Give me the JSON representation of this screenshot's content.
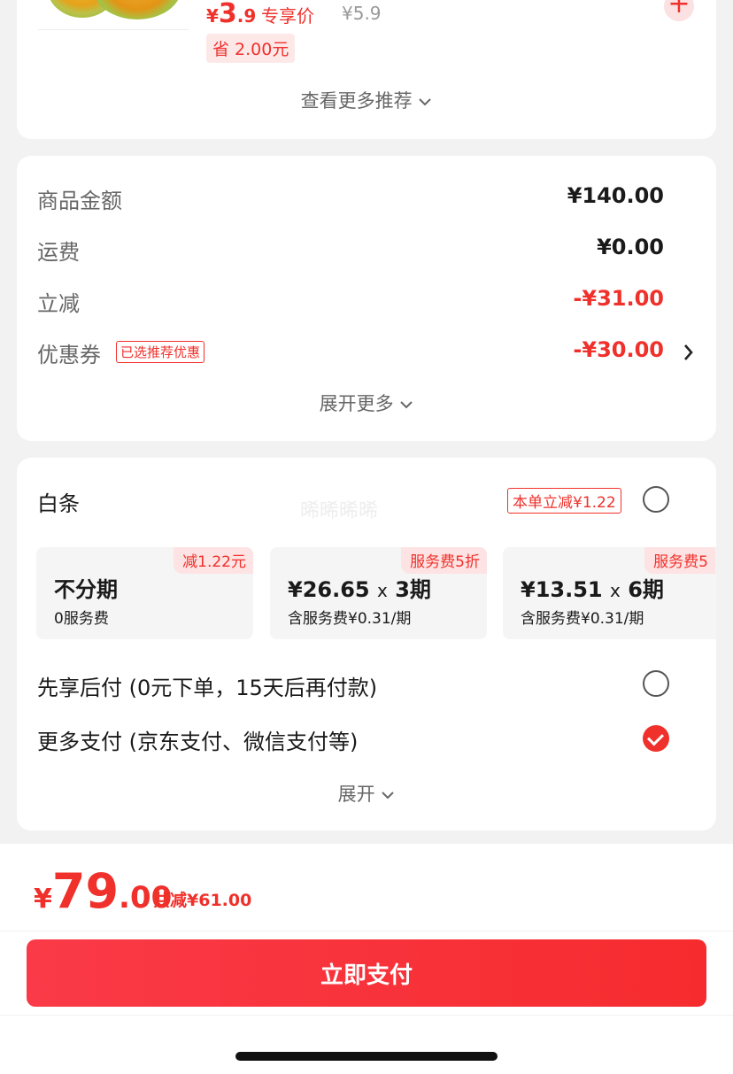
{
  "recommendation": {
    "price_symbol": "¥",
    "price_int": "3",
    "price_dec": ".9",
    "exclusive_label": "专享价",
    "original_price": "¥5.9",
    "save_label": "省 2.00元",
    "more_label": "查看更多推荐"
  },
  "amount": {
    "rows": [
      {
        "label": "商品金额",
        "value": "¥140.00"
      },
      {
        "label": "运费",
        "value": "¥0.00"
      },
      {
        "label": "立减",
        "value": "-¥31.00"
      },
      {
        "label": "优惠券",
        "value": "-¥30.00",
        "tag": "已选推荐优惠"
      }
    ],
    "expand_more": "展开更多"
  },
  "payment": {
    "baitiao_label": "白条",
    "watermark": "晞晞晞晞",
    "instant_discount": "本单立减¥1.22",
    "plans": [
      {
        "tag": "减1.22元",
        "main": "不分期",
        "sub": "0服务费"
      },
      {
        "tag": "服务费5折",
        "main_amount": "¥26.65",
        "x": "x",
        "periods": "3期",
        "sub": "含服务费¥0.31/期"
      },
      {
        "tag": "服务费5",
        "main_amount": "¥13.51",
        "x": "x",
        "periods": "6期",
        "sub": "含服务费¥0.31/期"
      }
    ],
    "options": [
      {
        "label": "先享后付 (0元下单，15天后再付款)",
        "checked": false
      },
      {
        "label": "更多支付 (京东支付、微信支付等)",
        "checked": true
      }
    ],
    "expand": "展开"
  },
  "checkout": {
    "total_symbol": "¥",
    "total_int": "79",
    "total_dec": ".00",
    "total_saved": "共减¥61.00",
    "pay_button": "立即支付"
  },
  "colors": {
    "accent": "#f0302b",
    "background": "#f2f2f2"
  }
}
